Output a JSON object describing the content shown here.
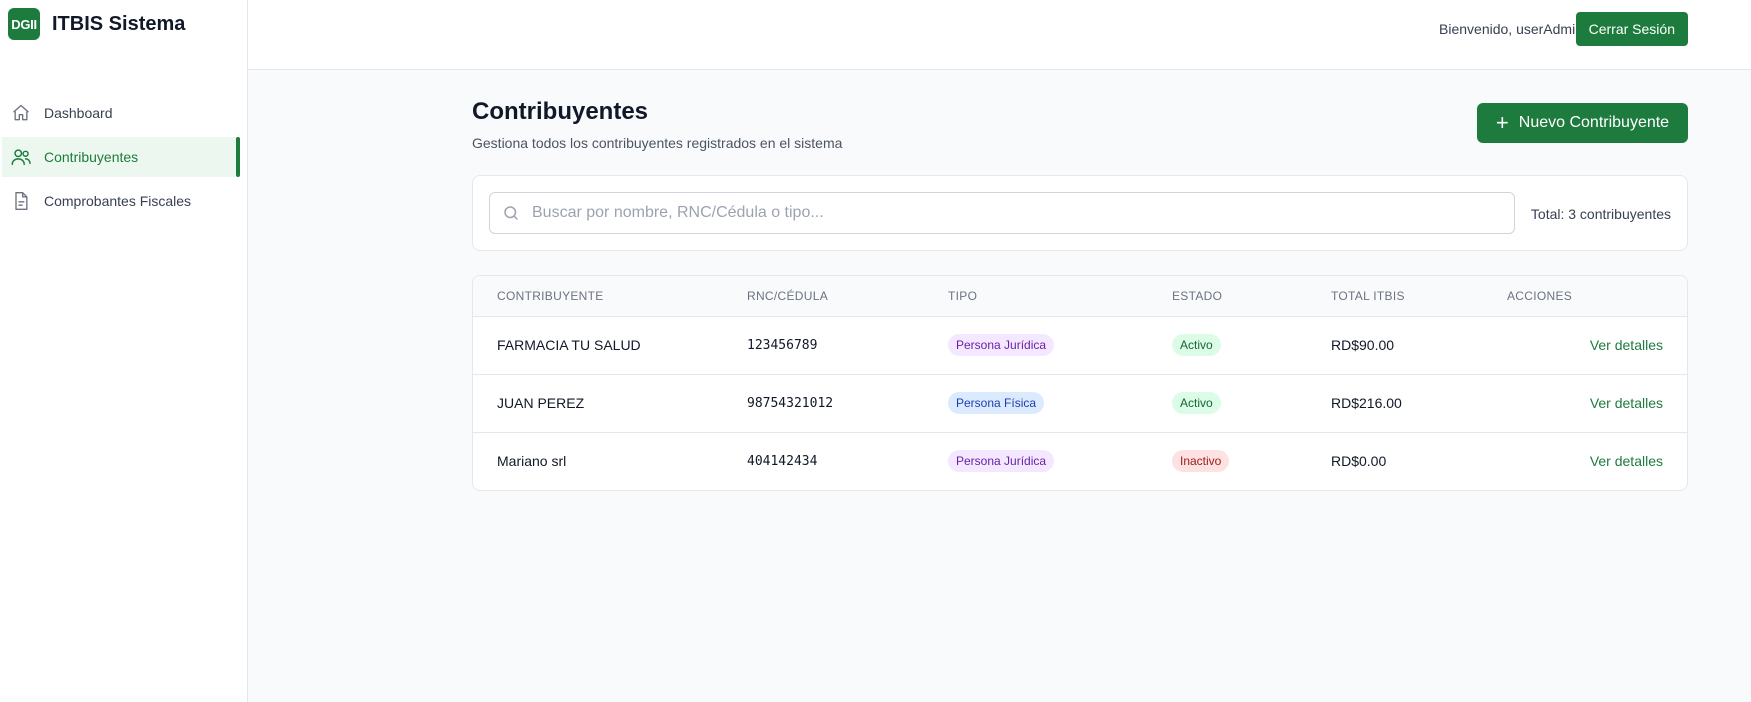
{
  "brand": {
    "logo_text": "DGII",
    "name": "ITBIS Sistema",
    "accent": "#1e7b3e"
  },
  "sidebar": {
    "items": [
      {
        "label": "Dashboard",
        "icon": "home-icon",
        "active": false
      },
      {
        "label": "Contribuyentes",
        "icon": "users-icon",
        "active": true
      },
      {
        "label": "Comprobantes Fiscales",
        "icon": "document-icon",
        "active": false
      }
    ]
  },
  "header": {
    "welcome": "Bienvenido, userAdmin",
    "logout_label": "Cerrar Sesión"
  },
  "main": {
    "title": "Contribuyentes",
    "subtitle": "Gestiona todos los contribuyentes registrados en el sistema",
    "new_button_label": "Nuevo Contribuyente",
    "search": {
      "placeholder": "Buscar por nombre, RNC/Cédula o tipo...",
      "value": ""
    },
    "total": "Total: 3 contribuyentes"
  },
  "table": {
    "headers": [
      "CONTRIBUYENTE",
      "RNC/CÉDULA",
      "TIPO",
      "ESTADO",
      "TOTAL ITBIS",
      "ACCIONES"
    ],
    "rows": [
      {
        "name": "FARMACIA TU SALUD",
        "rnc": "123456789",
        "tipo": "Persona Jurídica",
        "estado": "Activo",
        "total": "RD$90.00",
        "action": "Ver detalles"
      },
      {
        "name": "JUAN PEREZ",
        "rnc": "98754321012",
        "tipo": "Persona Física",
        "estado": "Activo",
        "total": "RD$216.00",
        "action": "Ver detalles"
      },
      {
        "name": "Mariano srl",
        "rnc": "404142434",
        "tipo": "Persona Jurídica",
        "estado": "Inactivo",
        "total": "RD$0.00",
        "action": "Ver detalles"
      }
    ]
  }
}
